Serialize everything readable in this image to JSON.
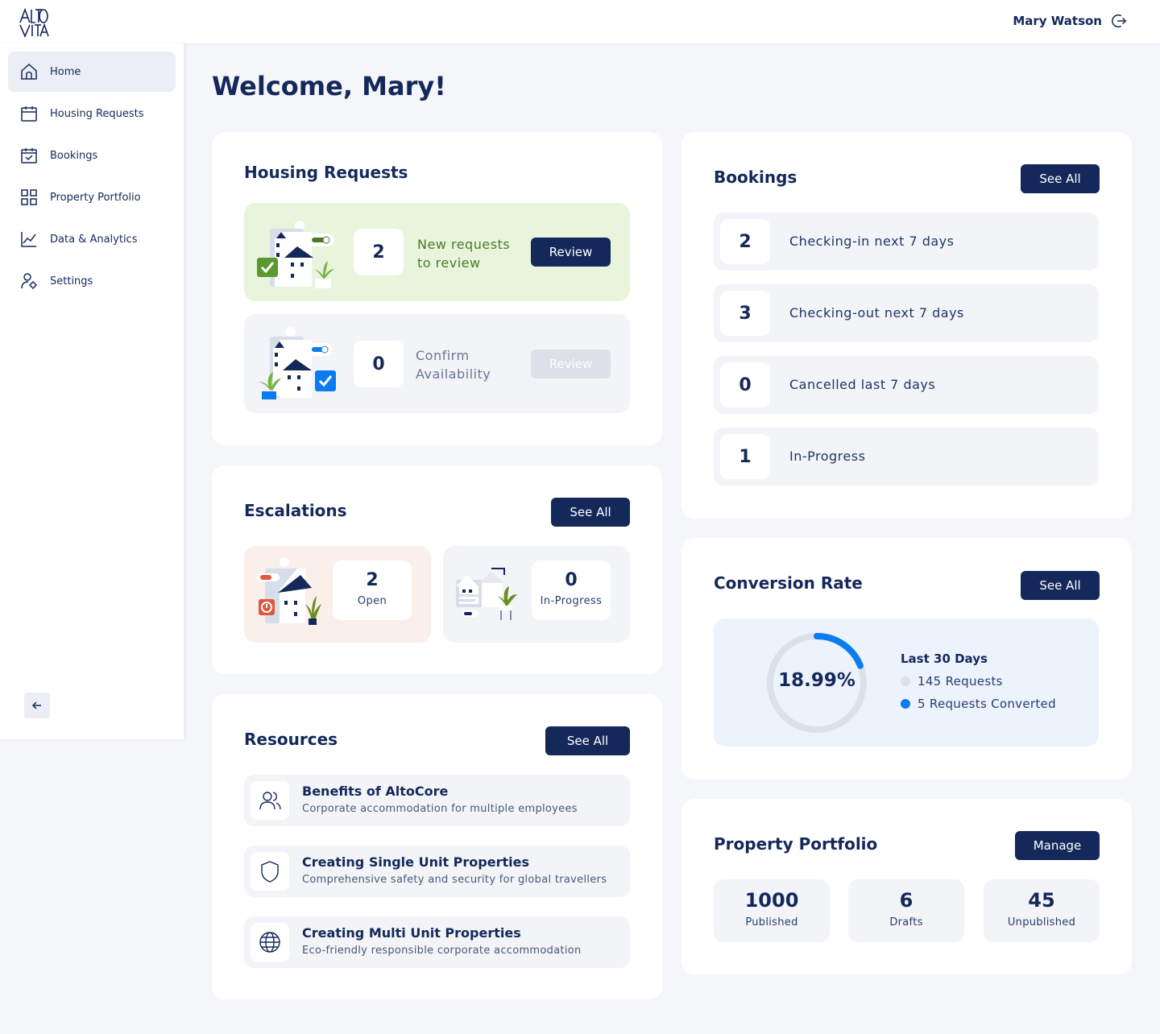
{
  "header": {
    "user_name": "Mary Watson"
  },
  "sidebar": {
    "items": [
      {
        "label": "Home",
        "icon": "home-icon"
      },
      {
        "label": "Housing Requests",
        "icon": "calendar-icon"
      },
      {
        "label": "Bookings",
        "icon": "calendar-check-icon"
      },
      {
        "label": "Property Portfolio",
        "icon": "grid-icon"
      },
      {
        "label": "Data & Analytics",
        "icon": "line-chart-icon"
      },
      {
        "label": "Settings",
        "icon": "user-settings-icon"
      }
    ]
  },
  "welcome": "Welcome, Mary!",
  "housing": {
    "title": "Housing Requests",
    "new_count": "2",
    "new_label_1": "New requests",
    "new_label_2": "to review",
    "new_button": "Review",
    "confirm_count": "0",
    "confirm_label_1": "Confirm",
    "confirm_label_2": "Availability",
    "confirm_button": "Review"
  },
  "escalations": {
    "title": "Escalations",
    "see_all": "See All",
    "open_count": "2",
    "open_label": "Open",
    "progress_count": "0",
    "progress_label": "In-Progress"
  },
  "resources": {
    "title": "Resources",
    "see_all": "See All",
    "items": [
      {
        "title": "Benefits of AltoCore",
        "subtitle": "Corporate accommodation for multiple employees",
        "icon": "users-icon"
      },
      {
        "title": "Creating Single Unit Properties",
        "subtitle": "Comprehensive safety and security for global travellers",
        "icon": "shield-icon"
      },
      {
        "title": "Creating Multi Unit Properties",
        "subtitle": "Eco-friendly responsible corporate accommodation",
        "icon": "globe-icon"
      }
    ]
  },
  "bookings": {
    "title": "Bookings",
    "see_all": "See All",
    "rows": [
      {
        "count": "2",
        "label": "Checking-in next 7 days"
      },
      {
        "count": "3",
        "label": "Checking-out next 7 days"
      },
      {
        "count": "0",
        "label": "Cancelled last 7 days"
      },
      {
        "count": "1",
        "label": "In-Progress"
      }
    ]
  },
  "conversion": {
    "title": "Conversion Rate",
    "see_all": "See All",
    "rate_text": "18.99%",
    "rate_fraction": 0.1899,
    "period": "Last 30 Days",
    "requests_label": "145 Requests",
    "converted_label": "5 Requests Converted",
    "colors": {
      "accent": "#0a7cf0",
      "track": "#dde0e8"
    }
  },
  "portfolio": {
    "title": "Property Portfolio",
    "manage": "Manage",
    "stats": [
      {
        "count": "1000",
        "label": "Published"
      },
      {
        "count": "6",
        "label": "Drafts"
      },
      {
        "count": "45",
        "label": "Unpublished"
      }
    ]
  },
  "colors": {
    "navy": "#14285a",
    "green_tile": "#e8f5dc",
    "green_text": "#4b7a2a",
    "pink_tile": "#fbefea",
    "blue_accent": "#0a7cf0"
  }
}
